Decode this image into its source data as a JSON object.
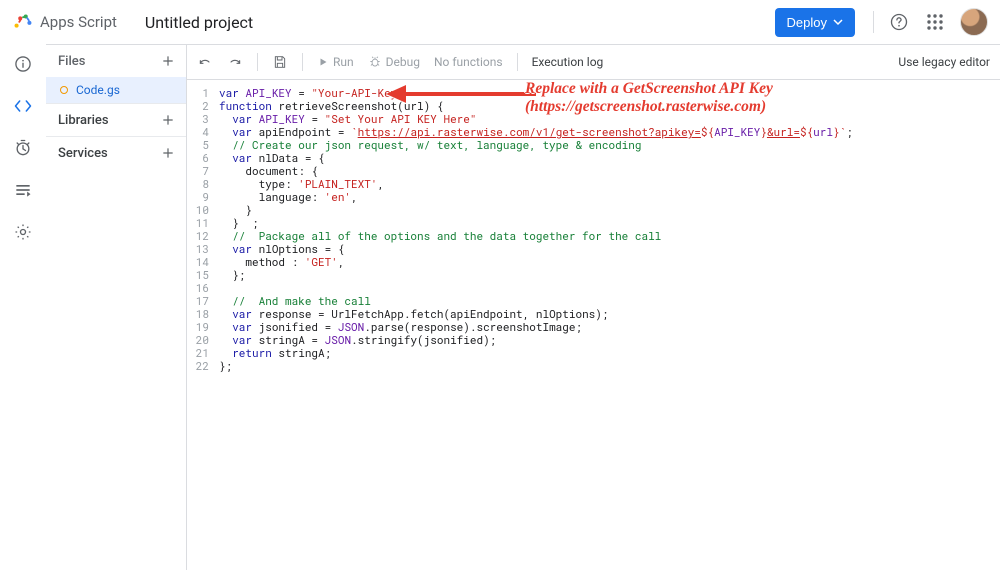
{
  "header": {
    "logoText": "Apps Script",
    "projectName": "Untitled project",
    "deployLabel": "Deploy"
  },
  "files": {
    "heading": "Files",
    "items": [
      "Code.gs"
    ],
    "libraries": "Libraries",
    "services": "Services"
  },
  "toolbar": {
    "run": "Run",
    "debug": "Debug",
    "nofunc": "No functions",
    "execlog": "Execution log",
    "legacy": "Use legacy editor"
  },
  "code": {
    "lines": [
      [
        [
          "kw",
          "var"
        ],
        [
          "obj",
          " "
        ],
        [
          "const",
          "API_KEY"
        ],
        [
          "obj",
          " = "
        ],
        [
          "str",
          "\"Your-API-Key\""
        ]
      ],
      [
        [
          "kw",
          "function"
        ],
        [
          "obj",
          " retrieveScreenshot(url) {"
        ]
      ],
      [
        [
          "obj",
          "  "
        ],
        [
          "kw",
          "var"
        ],
        [
          "obj",
          " "
        ],
        [
          "const",
          "API_KEY"
        ],
        [
          "obj",
          " = "
        ],
        [
          "str",
          "\"Set Your API KEY Here\""
        ]
      ],
      [
        [
          "obj",
          "  "
        ],
        [
          "kw",
          "var"
        ],
        [
          "obj",
          " apiEndpoint = "
        ],
        [
          "tl",
          "`"
        ],
        [
          "url",
          "https://api.rasterwise.com/v1/get-screenshot?apikey="
        ],
        [
          "tl",
          "${"
        ],
        [
          "tlvar",
          "API_KEY"
        ],
        [
          "tl",
          "}"
        ],
        [
          "url",
          "&url="
        ],
        [
          "tl",
          "${"
        ],
        [
          "tlvar",
          "url"
        ],
        [
          "tl",
          "}"
        ],
        [
          "tl",
          "`"
        ],
        [
          "obj",
          ";"
        ]
      ],
      [
        [
          "obj",
          "  "
        ],
        [
          "cmt",
          "// Create our json request, w/ text, language, type & encoding"
        ]
      ],
      [
        [
          "obj",
          "  "
        ],
        [
          "kw",
          "var"
        ],
        [
          "obj",
          " nlData = {"
        ]
      ],
      [
        [
          "obj",
          "    document: {"
        ]
      ],
      [
        [
          "obj",
          "      type: "
        ],
        [
          "str",
          "'PLAIN_TEXT'"
        ],
        [
          "obj",
          ","
        ]
      ],
      [
        [
          "obj",
          "      language: "
        ],
        [
          "str",
          "'en'"
        ],
        [
          "obj",
          ","
        ]
      ],
      [
        [
          "obj",
          "    }"
        ]
      ],
      [
        [
          "obj",
          "  }  ;"
        ]
      ],
      [
        [
          "obj",
          "  "
        ],
        [
          "cmt",
          "//  Package all of the options and the data together for the call"
        ]
      ],
      [
        [
          "obj",
          "  "
        ],
        [
          "kw",
          "var"
        ],
        [
          "obj",
          " nlOptions = {"
        ]
      ],
      [
        [
          "obj",
          "    method : "
        ],
        [
          "str",
          "'GET'"
        ],
        [
          "obj",
          ","
        ]
      ],
      [
        [
          "obj",
          "  };"
        ]
      ],
      [
        [
          "obj",
          ""
        ]
      ],
      [
        [
          "obj",
          "  "
        ],
        [
          "cmt",
          "//  And make the call"
        ]
      ],
      [
        [
          "obj",
          "  "
        ],
        [
          "kw",
          "var"
        ],
        [
          "obj",
          " response = UrlFetchApp.fetch(apiEndpoint, nlOptions);"
        ]
      ],
      [
        [
          "obj",
          "  "
        ],
        [
          "kw",
          "var"
        ],
        [
          "obj",
          " jsonified = "
        ],
        [
          "const",
          "JSON"
        ],
        [
          "obj",
          ".parse(response).screenshotImage;"
        ]
      ],
      [
        [
          "obj",
          "  "
        ],
        [
          "kw",
          "var"
        ],
        [
          "obj",
          " stringA = "
        ],
        [
          "const",
          "JSON"
        ],
        [
          "obj",
          ".stringify(jsonified);"
        ]
      ],
      [
        [
          "obj",
          "  "
        ],
        [
          "kw",
          "return"
        ],
        [
          "obj",
          " stringA;"
        ]
      ],
      [
        [
          "obj",
          "};"
        ]
      ]
    ]
  },
  "annotation": {
    "line1": "Replace with a GetScreenshot API Key",
    "line2": "(https://getscreenshot.rasterwise.com)"
  }
}
